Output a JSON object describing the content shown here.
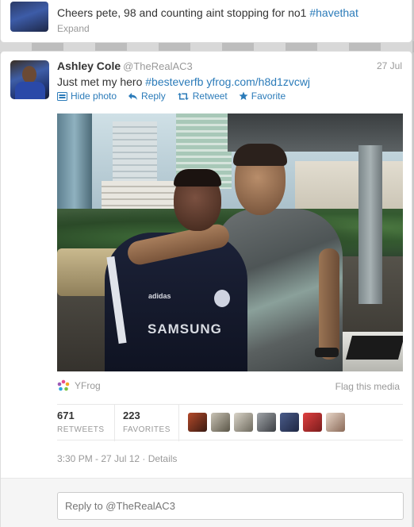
{
  "previous_tweet": {
    "text_before": "Cheers pete, 98 and counting aint stopping for no1 ",
    "hashtag": "#havethat",
    "expand_label": "Expand"
  },
  "tweet": {
    "fullname": "Ashley Cole",
    "username": "@TheRealAC3",
    "date": "27 Jul",
    "text_before": "Just met my hero ",
    "hashtag": "#besteverfb",
    "link": "yfrog.com/h8d1zvcwj",
    "photo_jersey_text": "SAMSUNG",
    "photo_jersey_brand": "adidas",
    "actions": {
      "hide_photo": "Hide photo",
      "reply": "Reply",
      "retweet": "Retweet",
      "favorite": "Favorite"
    },
    "media_source": "YFrog",
    "flag_media": "Flag this media",
    "stats": {
      "retweets_count": "671",
      "retweets_label": "RETWEETS",
      "favorites_count": "223",
      "favorites_label": "FAVORITES"
    },
    "meta": "3:30 PM - 27 Jul 12 · Details"
  },
  "reply_box": {
    "placeholder": "Reply to @TheRealAC3"
  },
  "colors": {
    "link": "#2b7bb9",
    "muted": "#999999",
    "text": "#333333"
  },
  "icons": [
    "hide-photo-icon",
    "reply-icon",
    "retweet-icon",
    "favorite-icon",
    "yfrog-icon"
  ]
}
